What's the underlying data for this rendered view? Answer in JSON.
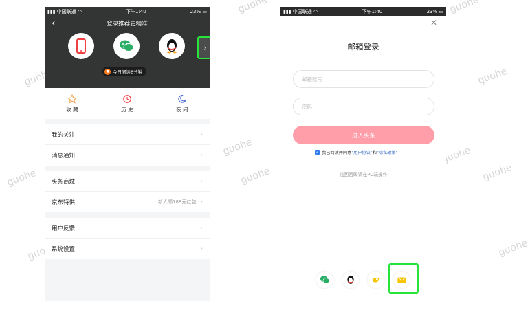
{
  "watermark": "guohe",
  "left_phone": {
    "status": {
      "carrier": "中国联通",
      "time": "下午1:40",
      "battery": "23%"
    },
    "header": {
      "title": "登录推荐更精准",
      "login_methods": [
        {
          "name": "phone",
          "icon": "phone-icon",
          "color": "#f04142"
        },
        {
          "name": "wechat",
          "icon": "wechat-icon",
          "color": "#2aae67"
        },
        {
          "name": "qq",
          "icon": "qq-penguin-icon",
          "color": "#111111"
        }
      ],
      "reading_time": "今日阅读6分钟"
    },
    "quick": [
      {
        "label": "收 藏",
        "icon": "star-icon",
        "color": "#f0a24a"
      },
      {
        "label": "历 史",
        "icon": "clock-icon",
        "color": "#f04142"
      },
      {
        "label": "夜 间",
        "icon": "moon-icon",
        "color": "#4f6bd8"
      }
    ],
    "menu_groups": [
      [
        {
          "label": "我的关注",
          "note": ""
        },
        {
          "label": "消息通知",
          "note": ""
        }
      ],
      [
        {
          "label": "头条商城",
          "note": ""
        },
        {
          "label": "京东特供",
          "note": "新人领188元红包"
        }
      ],
      [
        {
          "label": "用户反馈",
          "note": ""
        },
        {
          "label": "系统设置",
          "note": ""
        }
      ]
    ]
  },
  "right_phone": {
    "status": {
      "carrier": "中国联通",
      "time": "下午1:40",
      "battery": "23%"
    },
    "title": "邮箱登录",
    "email_placeholder": "邮箱账号",
    "password_placeholder": "密码",
    "submit_label": "进入头条",
    "agreement": {
      "prefix": "我已阅读并同意",
      "user_agreement": "\"用户协议\"",
      "and": "和",
      "privacy": "\"隐私政策\""
    },
    "recover_text": "找回密码请在PC端操作",
    "bottom_methods": [
      {
        "name": "wechat",
        "icon": "wechat-icon"
      },
      {
        "name": "qq",
        "icon": "qq-penguin-icon"
      },
      {
        "name": "tianyi",
        "icon": "tianyi-icon"
      },
      {
        "name": "email",
        "icon": "email-icon"
      }
    ]
  }
}
